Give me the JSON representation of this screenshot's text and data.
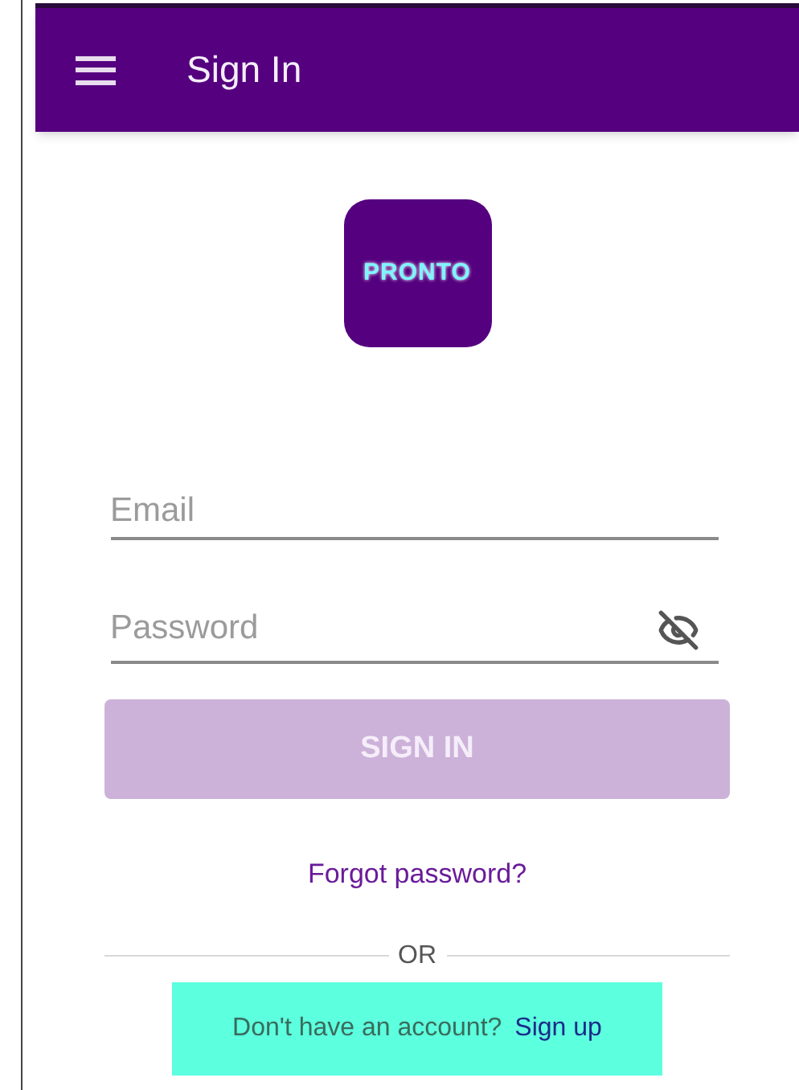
{
  "app_bar": {
    "title": "Sign In"
  },
  "logo": {
    "text": "PRONTO"
  },
  "email": {
    "placeholder": "Email"
  },
  "password": {
    "placeholder": "Password",
    "visible": false
  },
  "sign_in_button": {
    "label": "SIGN IN",
    "disabled": true
  },
  "forgot_link": "Forgot password?",
  "divider": "OR",
  "signup_prompt": {
    "text": "Don't have an account?",
    "link": "Sign up"
  }
}
